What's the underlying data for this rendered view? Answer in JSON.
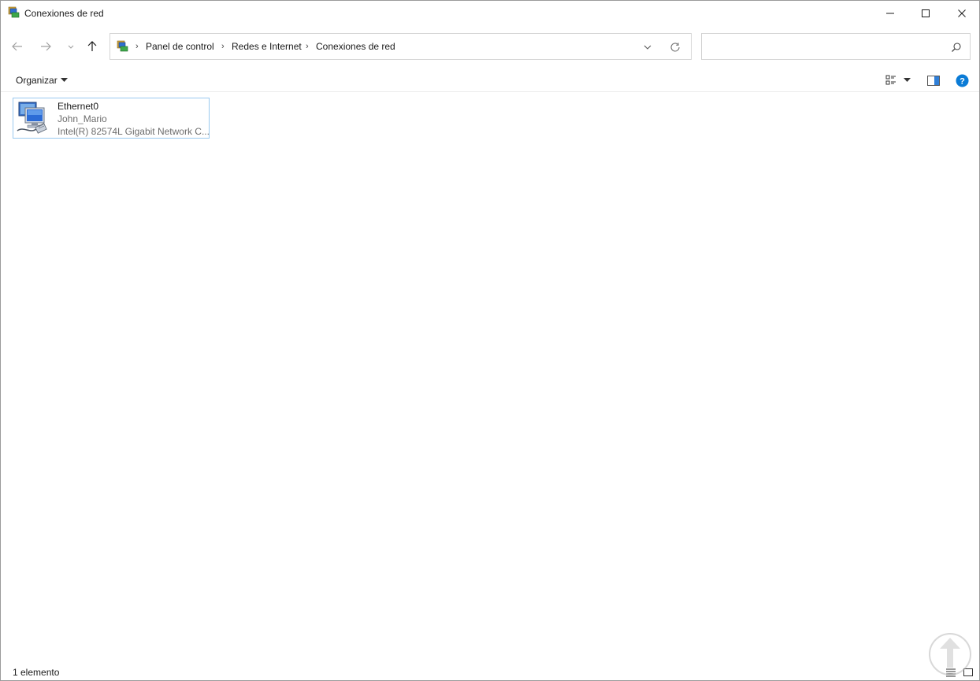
{
  "window": {
    "title": "Conexiones de red"
  },
  "nav": {
    "breadcrumb": [
      "Panel de control",
      "Redes e Internet",
      "Conexiones de red"
    ],
    "search_placeholder": ""
  },
  "toolbar": {
    "organize_label": "Organizar"
  },
  "items": [
    {
      "name": "Ethernet0",
      "network": "John_Mario",
      "adapter": "Intel(R) 82574L Gigabit Network C..."
    }
  ],
  "status": {
    "count": "1 elemento"
  },
  "colors": {
    "selection_border": "#99c9ef",
    "help_blue": "#0a7bd6",
    "secondary_text": "#6d6d6d"
  }
}
